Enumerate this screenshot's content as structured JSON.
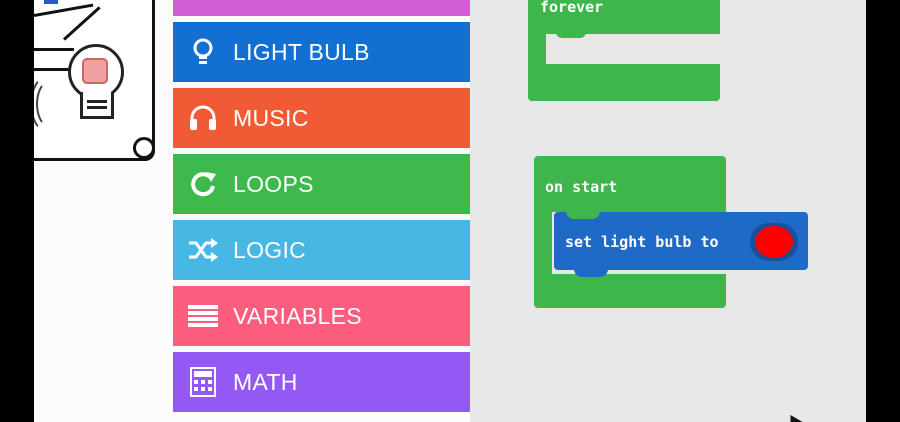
{
  "toolbox": {
    "categories": [
      {
        "label": "LIGHT BULB",
        "color": "#1270d3",
        "icon": "lightbulb-icon"
      },
      {
        "label": "MUSIC",
        "color": "#f05a35",
        "icon": "headphones-icon"
      },
      {
        "label": "LOOPS",
        "color": "#3dba4b",
        "icon": "loop-arrow-icon"
      },
      {
        "label": "LOGIC",
        "color": "#47b8e3",
        "icon": "shuffle-icon"
      },
      {
        "label": "VARIABLES",
        "color": "#fb5d7e",
        "icon": "list-lines-icon"
      },
      {
        "label": "MATH",
        "color": "#9458f5",
        "icon": "calculator-icon"
      }
    ],
    "partial_top_color": "#d25ed5"
  },
  "workspace": {
    "forever_block": {
      "label": "forever",
      "color": "#3fb64c"
    },
    "on_start_block": {
      "label": "on start",
      "color": "#3fb64c"
    },
    "set_block": {
      "label": "set light bulb to",
      "color": "#1f69c7",
      "value_color": "#ff0000"
    }
  }
}
